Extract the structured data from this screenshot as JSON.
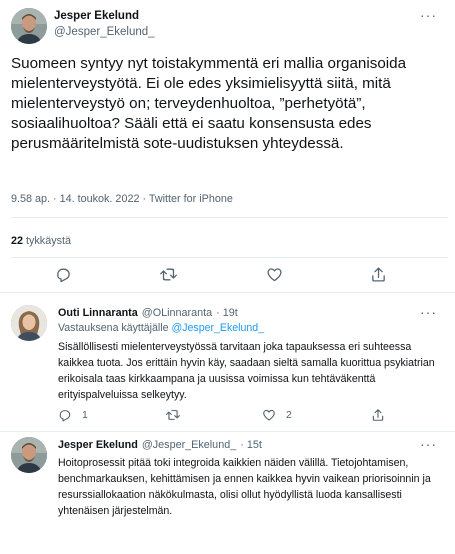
{
  "main_tweet": {
    "author_name": "Jesper Ekelund",
    "author_handle": "@Jesper_Ekelund_",
    "text": "Suomeen syntyy nyt toistakymmentä eri mallia organisoida mielenterveystyötä. Ei ole edes yksimielisyyttä siitä, mitä mielenterveystyö on; terveydenhuoltoa, ”perhetyötä”, sosiaalihuoltoa? Sääli että ei saatu konsensusta edes perusmääritelmistä sote-uudistuksen yhteydessä.",
    "timestamp": "9.58 ap. · 14. toukok. 2022 · Twitter for iPhone",
    "likes_count": "22",
    "likes_label": " tykkäystä"
  },
  "replies": [
    {
      "author_name": "Outi Linnaranta",
      "author_handle": "@OLinnaranta",
      "time": "· 19t",
      "reply_prefix": "Vastauksena käyttäjälle ",
      "reply_to": "@Jesper_Ekelund_",
      "text": "Sisällöllisesti mielenterveystyössä tarvitaan joka tapauksessa eri suhteessa kaikkea tuota. Jos erittäin hyvin käy, saadaan sieltä samalla kuorittua psykiatrian erikoisala taas kirkkaampana ja uusissa voimissa kun tehtäväkenttä erityispalveluissa selkeytyy.",
      "reply_count": "1",
      "like_count": "2"
    },
    {
      "author_name": "Jesper Ekelund",
      "author_handle": "@Jesper_Ekelund_",
      "time": "· 15t",
      "text": "Hoitoprosessit pitää toki integroida kaikkien näiden välillä. Tietojohtamisen, benchmarkauksen, kehittämisen ja ennen kaikkea hyvin vaikean priorisoinnin ja resurssiallokaation näkökulmasta, olisi ollut hyödyllistä luoda kansallisesti yhtenäisen järjestelmän."
    }
  ],
  "icons": {
    "reply": "reply-icon",
    "retweet": "retweet-icon",
    "like": "heart-icon",
    "share": "share-icon",
    "more": "more-icon"
  },
  "colors": {
    "link": "#1d9bf0",
    "secondary_text": "#536471",
    "divider": "#e6ecf0"
  }
}
